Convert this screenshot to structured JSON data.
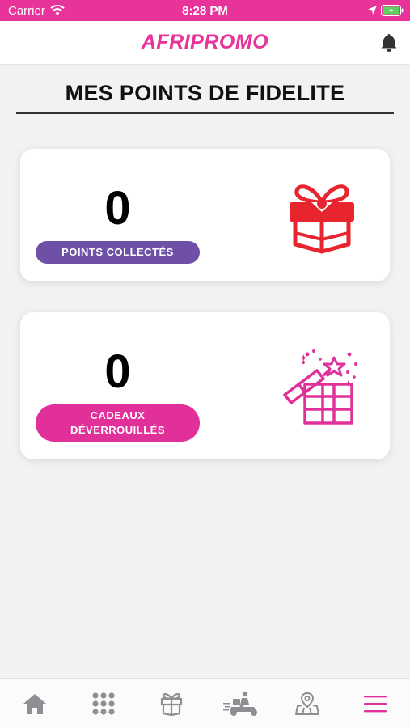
{
  "status_bar": {
    "carrier": "Carrier",
    "time": "8:28 PM"
  },
  "header": {
    "brand": "AFRIPROMO",
    "notification_icon": "bell-icon"
  },
  "page": {
    "title": "MES POINTS DE FIDELITE"
  },
  "cards": {
    "points": {
      "value": "0",
      "label": "POINTS COLLECTÉS",
      "label_color": "#6e51a6",
      "icon": "gift-box-icon",
      "icon_color": "#e8242f"
    },
    "gifts": {
      "value": "0",
      "label": "CADEAUX DÉVERROUILLÉS",
      "label_color": "#e2309b",
      "icon": "open-gift-stars-icon",
      "icon_color": "#e2309b"
    }
  },
  "tab_bar": {
    "items": [
      {
        "icon": "home-icon"
      },
      {
        "icon": "grid-icon"
      },
      {
        "icon": "gift-icon"
      },
      {
        "icon": "delivery-scooter-icon"
      },
      {
        "icon": "map-pin-icon"
      },
      {
        "icon": "menu-icon",
        "active": true
      }
    ]
  },
  "colors": {
    "brand": "#e7339a",
    "background": "#f2f1f3",
    "tab_inactive": "#8e8e93"
  }
}
